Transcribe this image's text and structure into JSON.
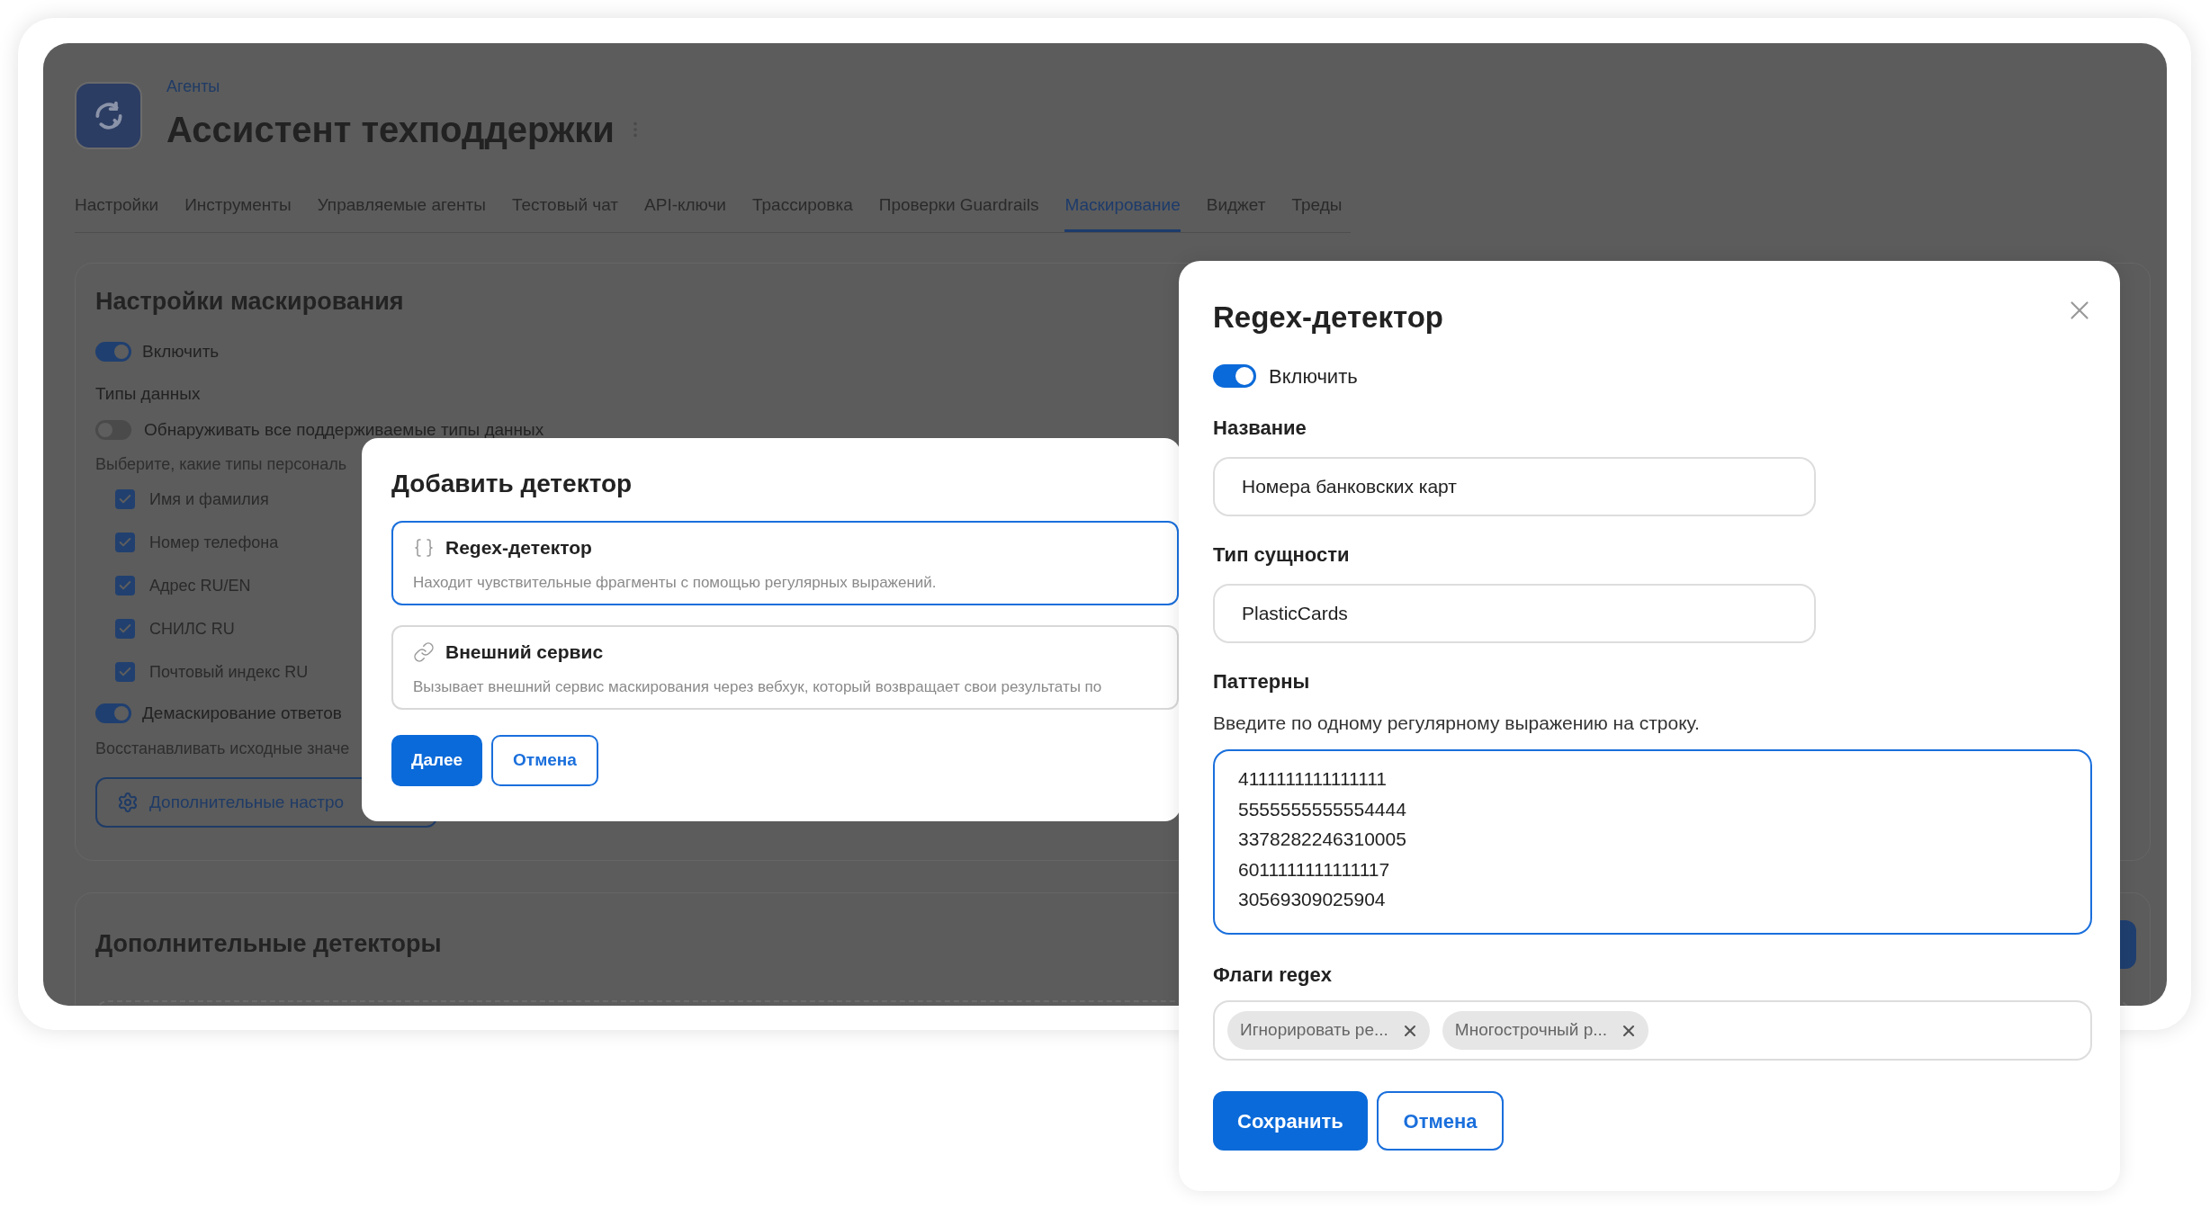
{
  "header": {
    "breadcrumb": "Агенты",
    "title": "Ассистент техподдержки"
  },
  "tabs": [
    {
      "label": "Настройки",
      "selected": false
    },
    {
      "label": "Инструменты",
      "selected": false
    },
    {
      "label": "Управляемые агенты",
      "selected": false
    },
    {
      "label": "Тестовый чат",
      "selected": false
    },
    {
      "label": "API-ключи",
      "selected": false
    },
    {
      "label": "Трассировка",
      "selected": false
    },
    {
      "label": "Проверки Guardrails",
      "selected": false
    },
    {
      "label": "Маскирование",
      "selected": true
    },
    {
      "label": "Виджет",
      "selected": false
    },
    {
      "label": "Треды",
      "selected": false
    }
  ],
  "masking_settings": {
    "title": "Настройки маскирования",
    "enable": {
      "label": "Включить",
      "on": true
    },
    "data_types_label": "Типы данных",
    "detect_all": {
      "label": "Обнаруживать все поддерживаемые типы данных",
      "on": false
    },
    "hint": "Выберите, какие типы персональ",
    "types": [
      {
        "label": "Имя и фамилия",
        "checked": true
      },
      {
        "label": "Номер телефона",
        "checked": true
      },
      {
        "label": "Адрес RU/EN",
        "checked": true
      },
      {
        "label": "СНИЛС RU",
        "checked": true
      },
      {
        "label": "Почтовый индекс RU",
        "checked": true
      }
    ],
    "unmask": {
      "label": "Демаскирование ответов",
      "on": true
    },
    "unmask_hint": "Восстанавливать исходные значе",
    "advanced_button": "Дополнительные настро"
  },
  "extra_detectors": {
    "title": "Дополнительные детекторы"
  },
  "add_detector": {
    "title": "Добавить детектор",
    "options": [
      {
        "kind": "regex",
        "title": "Regex-детектор",
        "description": "Находит чувствительные фрагменты с помощью регулярных выражений.",
        "selected": true
      },
      {
        "kind": "service",
        "title": "Внешний сервис",
        "description": "Вызывает внешний сервис маскирования через вебхук, который возвращает свои результаты по",
        "selected": false
      }
    ],
    "primary_button": "Далее",
    "cancel_button": "Отмена"
  },
  "regex_panel": {
    "title": "Regex-детектор",
    "enable": {
      "label": "Включить",
      "on": true
    },
    "name_label": "Название",
    "name_value": "Номера банковских карт",
    "entity_label": "Тип сущности",
    "entity_value": "PlasticCards",
    "patterns_label": "Паттерны",
    "patterns_hint": "Введите по одному регулярному выражению на строку.",
    "patterns": [
      "4111111111111111",
      "5555555555554444",
      "3378282246310005",
      "6011111111111117",
      "30569309025904"
    ],
    "flags_label": "Флаги regex",
    "flags": [
      "Игнорировать ре...",
      "Многострочный р..."
    ],
    "save_button": "Сохранить",
    "cancel_button": "Отмена"
  }
}
